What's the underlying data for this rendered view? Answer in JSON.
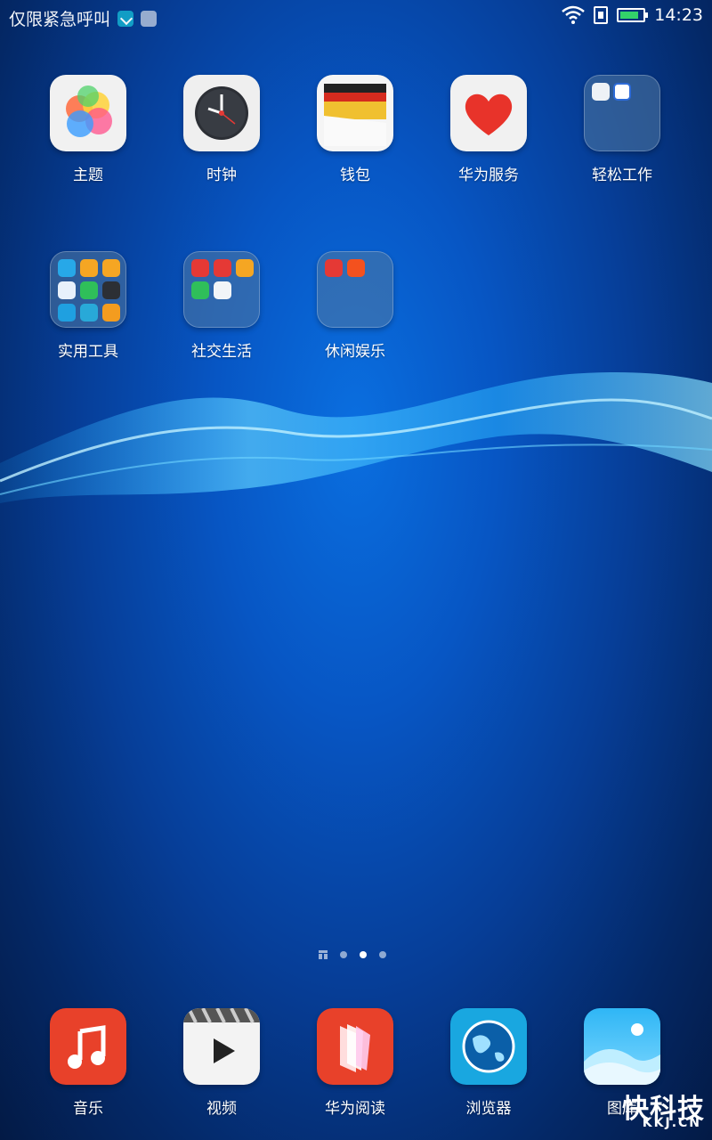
{
  "status_bar": {
    "carrier_text": "仅限紧急呼叫",
    "time": "14:23",
    "icons": [
      "note-icon",
      "image-icon",
      "wifi-icon",
      "sim-icon",
      "battery-charging-icon"
    ]
  },
  "home_apps": [
    {
      "label": "主题",
      "icon": "theme-icon"
    },
    {
      "label": "时钟",
      "icon": "clock-icon"
    },
    {
      "label": "钱包",
      "icon": "wallet-icon"
    },
    {
      "label": "华为服务",
      "icon": "heart-icon"
    },
    {
      "label": "轻松工作",
      "icon": "folder-icon"
    },
    {
      "label": "实用工具",
      "icon": "folder-icon"
    },
    {
      "label": "社交生活",
      "icon": "folder-icon"
    },
    {
      "label": "休闲娱乐",
      "icon": "folder-icon"
    }
  ],
  "pager": {
    "pages": 3,
    "active_page": 2
  },
  "dock": [
    {
      "label": "音乐",
      "icon": "music-icon"
    },
    {
      "label": "视频",
      "icon": "video-icon"
    },
    {
      "label": "华为阅读",
      "icon": "reader-icon"
    },
    {
      "label": "浏览器",
      "icon": "browser-icon"
    },
    {
      "label": "图库",
      "icon": "gallery-icon"
    }
  ],
  "watermark": {
    "main": "快科技",
    "sub": "KKJ.CN"
  },
  "colors": {
    "wallpaper_top": "#0a6fe0",
    "wallpaper_bottom": "#031a45",
    "battery_fill": "#33d26a"
  }
}
